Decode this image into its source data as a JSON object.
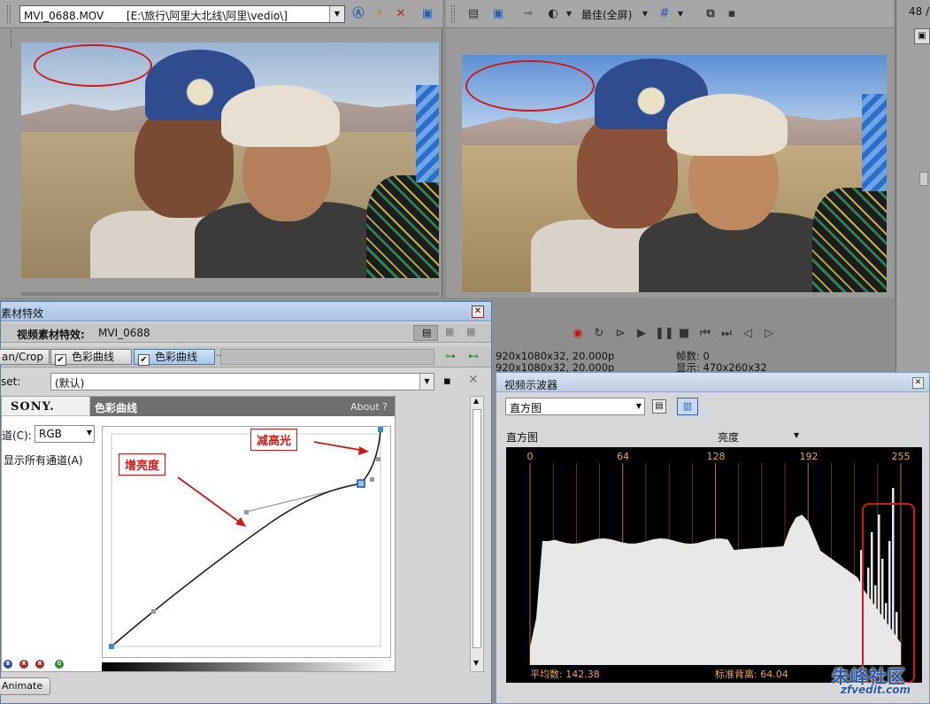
{
  "trimmer": {
    "file_label": "MVI_0688.MOV",
    "file_path": "[E:\\旅行\\阿里大北线\\阿里\\vedio\\]"
  },
  "preview": {
    "quality": "最佳(全屏)",
    "partial_right": "48 /",
    "info_line1_left": "920x1080x32, 20.000p",
    "info_line1_right": "帧数: 0",
    "info_line2_left": "920x1080x32, 20.000p",
    "info_line2_right": "显示: 470x260x32"
  },
  "fx": {
    "window_title": "素材特效",
    "header_label": "视频素材特效:",
    "clip_name": "MVI_0688",
    "chain": [
      "an/Crop",
      "色彩曲线",
      "色彩曲线"
    ],
    "preset_label": "set:",
    "preset_value": "(默认)",
    "plugin_brand": "SONY.",
    "plugin_name": "色彩曲线",
    "about": "About  ?",
    "channel_label": "道(C):",
    "channel_value": "RGB",
    "show_all_label": "显示所有通道(A)",
    "animate": "Animate"
  },
  "annotations": {
    "increase_brightness": "增亮度",
    "reduce_highlight": "减高光",
    "color": "#d01818"
  },
  "scopes": {
    "window_title": "视频示波器",
    "scope_type": "直方图",
    "hist_title": "直方图",
    "mode": "亮度",
    "ticks": [
      "0",
      "64",
      "128",
      "192",
      "255"
    ],
    "average_label": "平均数: 142.38",
    "stddev_label": "标准背离: 64.04"
  },
  "watermark": {
    "text": "朱峰社区",
    "sub": "zfvedit.com"
  }
}
